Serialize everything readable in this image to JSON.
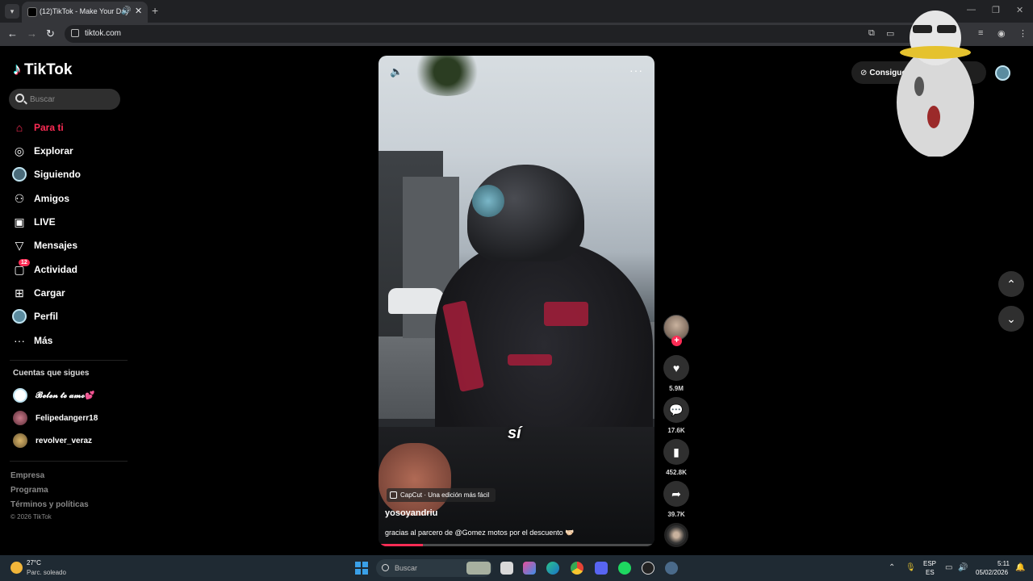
{
  "browser": {
    "tab_title": "(12)TikTok - Make Your Day",
    "tab_close": "✕",
    "new_tab": "+",
    "url": "tiktok.com",
    "window_controls": [
      "—",
      "❐",
      "✕"
    ]
  },
  "sidebar": {
    "logo_text": "TikTok",
    "search_placeholder": "Buscar",
    "nav": [
      {
        "label": "Para ti",
        "icon": "home-icon"
      },
      {
        "label": "Explorar",
        "icon": "compass-icon"
      },
      {
        "label": "Siguiendo",
        "icon": "following-avatar-icon"
      },
      {
        "label": "Amigos",
        "icon": "friends-icon"
      },
      {
        "label": "LIVE",
        "icon": "live-icon"
      },
      {
        "label": "Mensajes",
        "icon": "messages-icon"
      },
      {
        "label": "Actividad",
        "icon": "activity-icon",
        "badge": "12"
      },
      {
        "label": "Cargar",
        "icon": "upload-icon"
      },
      {
        "label": "Perfil",
        "icon": "profile-icon"
      },
      {
        "label": "Más",
        "icon": "more-icon"
      }
    ],
    "following_title": "Cuentas que sigues",
    "following": [
      {
        "name": "𝓑𝓮𝓵𝓮𝓷 𝓽𝓮 𝓪𝓶𝓸💕"
      },
      {
        "name": "Felipedangerr18"
      },
      {
        "name": "revolver_veraz"
      }
    ],
    "footer_links": [
      "Empresa",
      "Programa",
      "Términos y políticas"
    ],
    "copyright": "© 2026 TikTok"
  },
  "video": {
    "caption_overlay": "sí",
    "capcut_label": "CapCut · Una edición más fácil",
    "author": "yosoyandriu",
    "description": "gracias al parcero de @Gomez motos por el descuento 🤝🏻",
    "progress": 0.16
  },
  "actions": {
    "likes": "5.9M",
    "comments": "17.6K",
    "saves": "452.8K",
    "shares": "39.7K"
  },
  "top_right": {
    "get_app_label": "Consigue"
  },
  "taskbar": {
    "temperature": "27°C",
    "weather": "Parc. soleado",
    "search_label": "Buscar",
    "lang_top": "ESP",
    "lang_bottom": "ES",
    "time": "5:11",
    "date": "05/02/2026"
  },
  "colors": {
    "accent": "#fe2c55",
    "background": "#000000"
  }
}
